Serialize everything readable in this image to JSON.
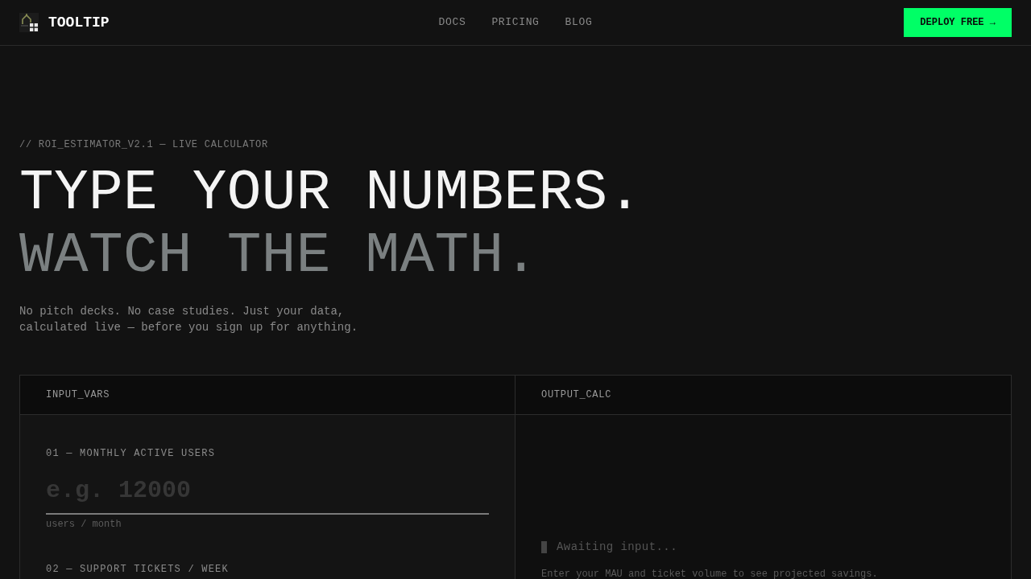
{
  "header": {
    "logo": "TOOLTIP",
    "nav": [
      "DOCS",
      "PRICING",
      "BLOG"
    ],
    "cta": "DEPLOY FREE →"
  },
  "hero": {
    "eyebrow": "// ROI_ESTIMATOR_V2.1 — LIVE CALCULATOR",
    "headline": [
      "TYPE YOUR NUMBERS.",
      "WATCH THE MATH."
    ],
    "subtitle": "No pitch decks. No case studies. Just your data, calculated live — before you sign up for anything."
  },
  "calculator": {
    "input_panel": {
      "title": "INPUT_VARS",
      "fields": [
        {
          "label": "01 — MONTHLY ACTIVE USERS",
          "placeholder": "e.g. 12000",
          "unit": "users / month"
        },
        {
          "label": "02 — SUPPORT TICKETS / WEEK"
        }
      ]
    },
    "output_panel": {
      "title": "OUTPUT_CALC",
      "status": "Awaiting input...",
      "hint": "Enter your MAU and ticket volume to see projected savings."
    }
  }
}
